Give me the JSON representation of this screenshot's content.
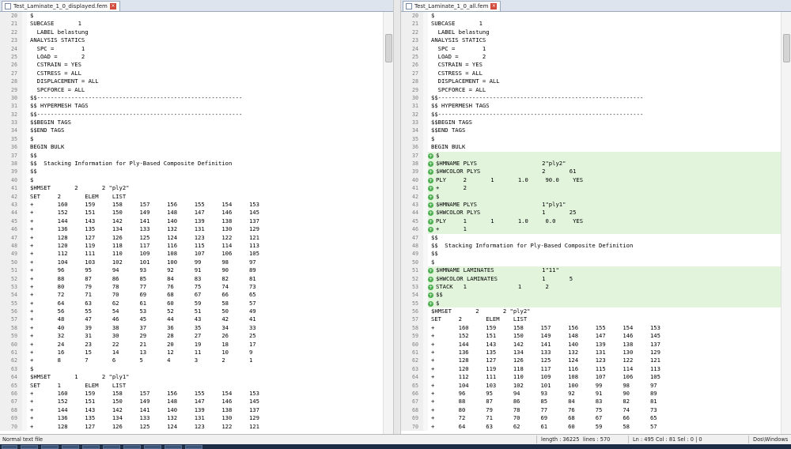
{
  "left": {
    "tab_title": "Test_Laminate_1_0_displayed.fem",
    "lines": [
      {
        "n": "20",
        "t": "$"
      },
      {
        "n": "21",
        "t": "SUBCASE       1"
      },
      {
        "n": "22",
        "t": "  LABEL belastung"
      },
      {
        "n": "23",
        "t": "ANALYSIS STATICS"
      },
      {
        "n": "24",
        "t": "  SPC =        1"
      },
      {
        "n": "25",
        "t": "  LOAD =       2"
      },
      {
        "n": "26",
        "t": "  CSTRAIN = YES"
      },
      {
        "n": "27",
        "t": "  CSTRESS = ALL"
      },
      {
        "n": "28",
        "t": "  DISPLACEMENT = ALL"
      },
      {
        "n": "29",
        "t": "  SPCFORCE = ALL"
      },
      {
        "n": "30",
        "t": "$$------------------------------------------------------------"
      },
      {
        "n": "31",
        "t": "$$ HYPERMESH TAGS"
      },
      {
        "n": "32",
        "t": "$$------------------------------------------------------------"
      },
      {
        "n": "33",
        "t": "$$BEGIN TAGS"
      },
      {
        "n": "34",
        "t": "$$END TAGS"
      },
      {
        "n": "35",
        "t": "$"
      },
      {
        "n": "36",
        "t": "BEGIN BULK"
      },
      {
        "n": "37",
        "t": "$$"
      },
      {
        "n": "38",
        "t": "$$  Stacking Information for Ply-Based Composite Definition"
      },
      {
        "n": "39",
        "t": "$$"
      },
      {
        "n": "40",
        "t": "$"
      },
      {
        "n": "41",
        "t": "$HMSET       2       2 \"ply2\""
      },
      {
        "n": "42",
        "t": "SET     2       ELEM    LIST"
      },
      {
        "n": "43",
        "t": "+       160     159     158     157     156     155     154     153"
      },
      {
        "n": "44",
        "t": "+       152     151     150     149     148     147     146     145"
      },
      {
        "n": "45",
        "t": "+       144     143     142     141     140     139     138     137"
      },
      {
        "n": "46",
        "t": "+       136     135     134     133     132     131     130     129"
      },
      {
        "n": "47",
        "t": "+       128     127     126     125     124     123     122     121"
      },
      {
        "n": "48",
        "t": "+       120     119     118     117     116     115     114     113"
      },
      {
        "n": "49",
        "t": "+       112     111     110     109     108     107     106     105"
      },
      {
        "n": "50",
        "t": "+       104     103     102     101     100     99      98      97"
      },
      {
        "n": "51",
        "t": "+       96      95      94      93      92      91      90      89"
      },
      {
        "n": "52",
        "t": "+       88      87      86      85      84      83      82      81"
      },
      {
        "n": "53",
        "t": "+       80      79      78      77      76      75      74      73"
      },
      {
        "n": "54",
        "t": "+       72      71      70      69      68      67      66      65"
      },
      {
        "n": "55",
        "t": "+       64      63      62      61      60      59      58      57"
      },
      {
        "n": "56",
        "t": "+       56      55      54      53      52      51      50      49"
      },
      {
        "n": "57",
        "t": "+       48      47      46      45      44      43      42      41"
      },
      {
        "n": "58",
        "t": "+       40      39      38      37      36      35      34      33"
      },
      {
        "n": "59",
        "t": "+       32      31      30      29      28      27      26      25"
      },
      {
        "n": "60",
        "t": "+       24      23      22      21      20      19      18      17"
      },
      {
        "n": "61",
        "t": "+       16      15      14      13      12      11      10      9"
      },
      {
        "n": "62",
        "t": "+       8       7       6       5       4       3       2       1"
      },
      {
        "n": "63",
        "t": "$"
      },
      {
        "n": "64",
        "t": "$HMSET       1       2 \"ply1\""
      },
      {
        "n": "65",
        "t": "SET     1       ELEM    LIST"
      },
      {
        "n": "66",
        "t": "+       160     159     158     157     156     155     154     153"
      },
      {
        "n": "67",
        "t": "+       152     151     150     149     148     147     146     145"
      },
      {
        "n": "68",
        "t": "+       144     143     142     141     140     139     138     137"
      },
      {
        "n": "69",
        "t": "+       136     135     134     133     132     131     130     129"
      },
      {
        "n": "70",
        "t": "+       128     127     126     125     124     123     122     121"
      }
    ]
  },
  "right": {
    "tab_title": "Test_Laminate_1_0_all.fem",
    "lines": [
      {
        "n": "20",
        "t": "$"
      },
      {
        "n": "21",
        "t": "SUBCASE       1"
      },
      {
        "n": "22",
        "t": "  LABEL belastung"
      },
      {
        "n": "23",
        "t": "ANALYSIS STATICS"
      },
      {
        "n": "24",
        "t": "  SPC =        1"
      },
      {
        "n": "25",
        "t": "  LOAD =       2"
      },
      {
        "n": "26",
        "t": "  CSTRAIN = YES"
      },
      {
        "n": "27",
        "t": "  CSTRESS = ALL"
      },
      {
        "n": "28",
        "t": "  DISPLACEMENT = ALL"
      },
      {
        "n": "29",
        "t": "  SPCFORCE = ALL"
      },
      {
        "n": "30",
        "t": "$$------------------------------------------------------------"
      },
      {
        "n": "31",
        "t": "$$ HYPERMESH TAGS"
      },
      {
        "n": "32",
        "t": "$$------------------------------------------------------------"
      },
      {
        "n": "33",
        "t": "$$BEGIN TAGS"
      },
      {
        "n": "34",
        "t": "$$END TAGS"
      },
      {
        "n": "35",
        "t": "$"
      },
      {
        "n": "36",
        "t": "BEGIN BULK"
      },
      {
        "n": "37",
        "t": "$",
        "a": true
      },
      {
        "n": "38",
        "t": "$HMNAME PLYS                   2\"ply2\"",
        "a": true
      },
      {
        "n": "39",
        "t": "$HWCOLOR PLYS                  2       61",
        "a": true
      },
      {
        "n": "40",
        "t": "PLY     2       1       1.0     90.0    YES",
        "a": true
      },
      {
        "n": "41",
        "t": "+       2",
        "a": true
      },
      {
        "n": "42",
        "t": "$",
        "a": true
      },
      {
        "n": "43",
        "t": "$HMNAME PLYS                   1\"ply1\"",
        "a": true
      },
      {
        "n": "44",
        "t": "$HWCOLOR PLYS                  1       25",
        "a": true
      },
      {
        "n": "45",
        "t": "PLY     1       1       1.0     0.0     YES",
        "a": true
      },
      {
        "n": "46",
        "t": "+       1",
        "a": true
      },
      {
        "n": "47",
        "t": "$$"
      },
      {
        "n": "48",
        "t": "$$  Stacking Information for Ply-Based Composite Definition"
      },
      {
        "n": "49",
        "t": "$$"
      },
      {
        "n": "50",
        "t": "$"
      },
      {
        "n": "51",
        "t": "$HMNAME LAMINATES              1\"11\"",
        "a": true
      },
      {
        "n": "52",
        "t": "$HWCOLOR LAMINATES             1       5",
        "a": true
      },
      {
        "n": "53",
        "t": "STACK   1               1       2",
        "a": true
      },
      {
        "n": "54",
        "t": "$$",
        "a": true
      },
      {
        "n": "55",
        "t": "$",
        "a": true
      },
      {
        "n": "56",
        "t": "$HMSET       2       2 \"ply2\""
      },
      {
        "n": "57",
        "t": "SET     2       ELEM    LIST"
      },
      {
        "n": "58",
        "t": "+       160     159     158     157     156     155     154     153"
      },
      {
        "n": "59",
        "t": "+       152     151     150     149     148     147     146     145"
      },
      {
        "n": "60",
        "t": "+       144     143     142     141     140     139     138     137"
      },
      {
        "n": "61",
        "t": "+       136     135     134     133     132     131     130     129"
      },
      {
        "n": "62",
        "t": "+       128     127     126     125     124     123     122     121"
      },
      {
        "n": "63",
        "t": "+       120     119     118     117     116     115     114     113"
      },
      {
        "n": "64",
        "t": "+       112     111     110     109     108     107     106     105"
      },
      {
        "n": "65",
        "t": "+       104     103     102     101     100     99      98      97"
      },
      {
        "n": "66",
        "t": "+       96      95      94      93      92      91      90      89"
      },
      {
        "n": "67",
        "t": "+       88      87      86      85      84      83      82      81"
      },
      {
        "n": "68",
        "t": "+       80      79      78      77      76      75      74      73"
      },
      {
        "n": "69",
        "t": "+       72      71      70      69      68      67      66      65"
      },
      {
        "n": "70",
        "t": "+       64      63      62      61      60      59      58      57"
      }
    ]
  },
  "status": {
    "file_type": "Normal text file",
    "length": "length : 36225",
    "lines": "lines : 570",
    "position": "Ln : 495   Col : 81   Sel : 0 | 0",
    "eol": "Dos\\Windows"
  },
  "colors": {
    "added_bg": "#e2f5dc",
    "marker": "#4caf50",
    "taskbar": "#1c2c44"
  },
  "icons": {
    "tab": "file-icon",
    "close": "close-icon",
    "diff": "plus-circle-icon"
  }
}
